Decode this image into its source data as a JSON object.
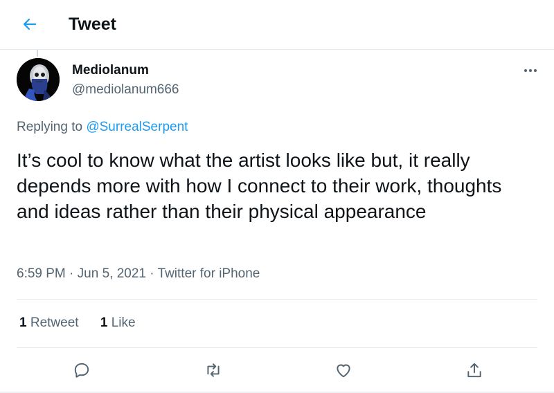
{
  "header": {
    "title": "Tweet",
    "back_icon": "arrow-left-icon"
  },
  "author": {
    "name": "Mediolanum",
    "handle": "@mediolanum666",
    "avatar_icon": "avatar-image-icon"
  },
  "more_icon": "more-dots-icon",
  "reply": {
    "prefix": "Replying to",
    "mention": "@SurrealSerpent"
  },
  "tweet": {
    "text": "It’s cool to know what the artist looks like but, it really depends more with how I connect to their work, thoughts and ideas rather than their physical appearance"
  },
  "meta": {
    "time": "6:59 PM",
    "date": "Jun 5, 2021",
    "source": "Twitter for iPhone",
    "separator": "·"
  },
  "stats": {
    "retweets_count": "1",
    "retweets_label": "Retweet",
    "likes_count": "1",
    "likes_label": "Like"
  },
  "actions": [
    "reply-icon",
    "retweet-icon",
    "like-icon",
    "share-icon"
  ],
  "colors": {
    "accent": "#1d9bf0",
    "text": "#0f1419",
    "secondary": "#536471",
    "border": "#e6ecf0"
  }
}
